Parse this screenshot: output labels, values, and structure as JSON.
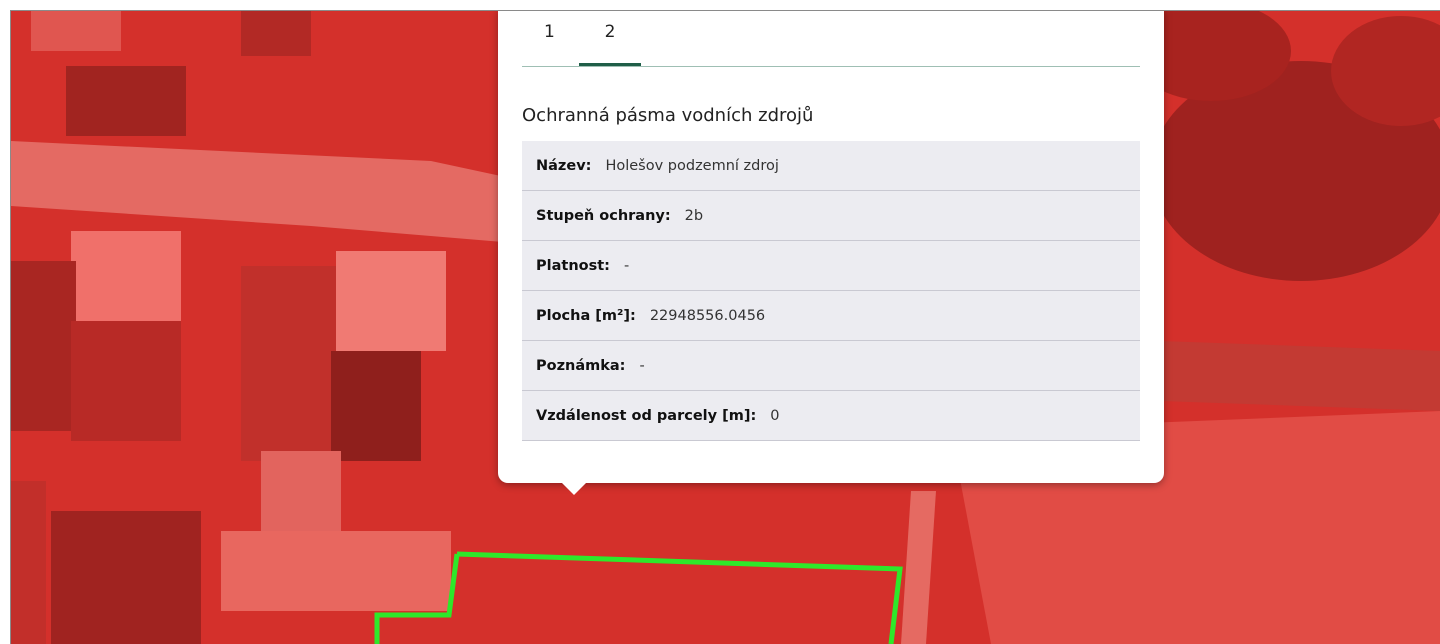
{
  "colors": {
    "overlay": "#d62f2a",
    "parcel_outline": "#2ee82a",
    "tab_active": "#1f5e48",
    "row_bg": "#ececf1"
  },
  "popup": {
    "tabs": [
      {
        "label": "1"
      },
      {
        "label": "2"
      }
    ],
    "active_tab": "2",
    "title": "Ochranná pásma vodních zdrojů",
    "rows": [
      {
        "label": "Název:",
        "value": "Holešov podzemní zdroj"
      },
      {
        "label": "Stupeň ochrany:",
        "value": "2b"
      },
      {
        "label": "Platnost:",
        "value": "-"
      },
      {
        "label": "Plocha [m²]:",
        "value": "22948556.0456"
      },
      {
        "label": "Poznámka:",
        "value": "-"
      },
      {
        "label": "Vzdálenost od parcely [m]:",
        "value": "0"
      }
    ]
  }
}
